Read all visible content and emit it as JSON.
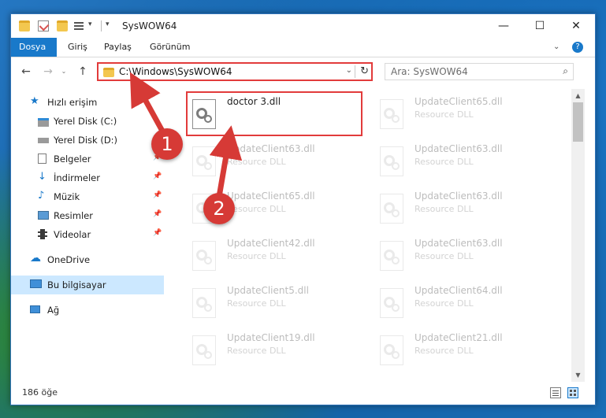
{
  "window": {
    "title": "SysWOW64",
    "controls": [
      "—",
      "☐",
      "✕"
    ]
  },
  "ribbon": {
    "tabs": [
      "Dosya",
      "Giriş",
      "Paylaş",
      "Görünüm"
    ],
    "active_tab": "Dosya",
    "accent_color": "#1979ca"
  },
  "nav": {
    "address_path": "C:\\Windows\\SysWOW64",
    "search_placeholder": "Ara: SysWOW64"
  },
  "sidebar": {
    "items": [
      {
        "label": "Hızlı erişim",
        "icon": "star-icon"
      },
      {
        "label": "Yerel Disk (C:)",
        "icon": "drive-icon"
      },
      {
        "label": "Yerel Disk (D:)",
        "icon": "drive-icon"
      },
      {
        "label": "Belgeler",
        "icon": "documents-icon",
        "pinned": true
      },
      {
        "label": "İndirmeler",
        "icon": "download-icon",
        "pinned": true
      },
      {
        "label": "Müzik",
        "icon": "music-icon",
        "pinned": true
      },
      {
        "label": "Resimler",
        "icon": "pictures-icon",
        "pinned": true
      },
      {
        "label": "Videolar",
        "icon": "videos-icon",
        "pinned": true
      },
      {
        "label": "OneDrive",
        "icon": "cloud-icon"
      },
      {
        "label": "Bu bilgisayar",
        "icon": "computer-icon",
        "selected": true
      },
      {
        "label": "Ağ",
        "icon": "network-icon"
      }
    ]
  },
  "files": [
    {
      "name": "doctor 3.dll",
      "type": "",
      "highlighted": true
    },
    {
      "name": "UpdateClient65.dll",
      "type": "Resource DLL"
    },
    {
      "name": "UpdateClient63.dll",
      "type": "Resource DLL"
    },
    {
      "name": "UpdateClient63.dll",
      "type": "Resource DLL"
    },
    {
      "name": "UpdateClient65.dll",
      "type": "Resource DLL"
    },
    {
      "name": "UpdateClient63.dll",
      "type": "Resource DLL"
    },
    {
      "name": "UpdateClient42.dll",
      "type": "Resource DLL"
    },
    {
      "name": "UpdateClient63.dll",
      "type": "Resource DLL"
    },
    {
      "name": "UpdateClient5.dll",
      "type": "Resource DLL"
    },
    {
      "name": "UpdateClient64.dll",
      "type": "Resource DLL"
    },
    {
      "name": "UpdateClient19.dll",
      "type": "Resource DLL"
    },
    {
      "name": "UpdateClient21.dll",
      "type": "Resource DLL"
    }
  ],
  "status": {
    "item_count": "186 öğe"
  },
  "annotations": {
    "markers": [
      "1",
      "2"
    ],
    "color": "#d63a36"
  }
}
